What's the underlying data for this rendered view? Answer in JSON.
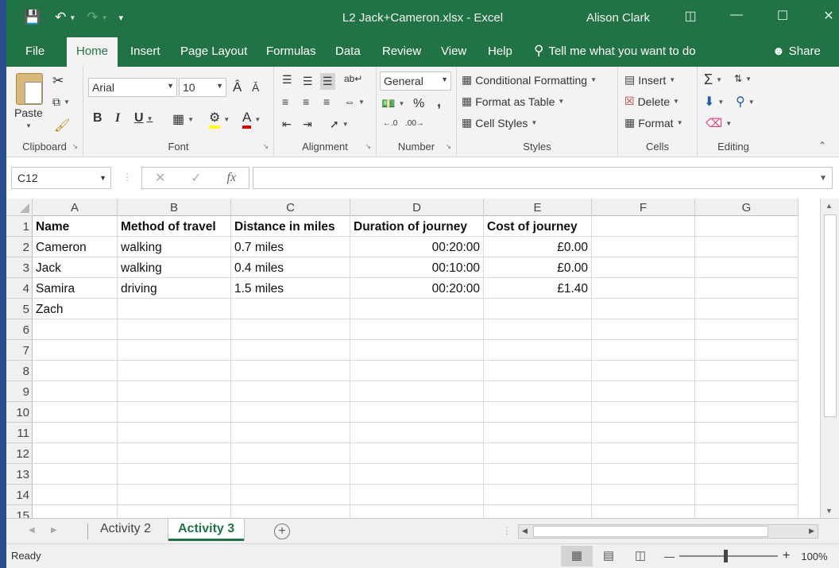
{
  "window": {
    "title": "L2 Jack+Cameron.xlsx  -  Excel",
    "user": "Alison Clark",
    "qat": {
      "save_icon": "save-icon",
      "undo_icon": "undo-icon",
      "redo_icon": "redo-icon"
    }
  },
  "tabs": [
    "File",
    "Home",
    "Insert",
    "Page Layout",
    "Formulas",
    "Data",
    "Review",
    "View",
    "Help"
  ],
  "tell_me": "Tell me what you want to do",
  "share": "Share",
  "ribbon": {
    "clipboard": {
      "label": "Clipboard",
      "paste": "Paste"
    },
    "font": {
      "label": "Font",
      "name": "Arial",
      "size": "10"
    },
    "alignment": {
      "label": "Alignment"
    },
    "number": {
      "label": "Number",
      "format": "General",
      "percent": "%",
      "comma": ","
    },
    "styles": {
      "label": "Styles",
      "conditional": "Conditional Formatting",
      "format_table": "Format as Table",
      "cell_styles": "Cell Styles"
    },
    "cells": {
      "label": "Cells",
      "insert": "Insert",
      "delete": "Delete",
      "format": "Format"
    },
    "editing": {
      "label": "Editing"
    }
  },
  "formula_bar": {
    "name_box": "C12",
    "fx": "fx",
    "value": ""
  },
  "sheet": {
    "columns": [
      "A",
      "B",
      "C",
      "D",
      "E",
      "F",
      "G"
    ],
    "rows": [
      "1",
      "2",
      "3",
      "4",
      "5",
      "6",
      "7",
      "8",
      "9",
      "10",
      "11",
      "12",
      "13",
      "14",
      "15"
    ],
    "cells": [
      [
        "Name",
        "Method of travel",
        "Distance in miles",
        "Duration of journey",
        "Cost of journey",
        "",
        ""
      ],
      [
        "Cameron",
        "walking",
        "0.7 miles",
        "00:20:00",
        "£0.00",
        "",
        ""
      ],
      [
        "Jack",
        "walking",
        "0.4 miles",
        "00:10:00",
        "£0.00",
        "",
        ""
      ],
      [
        "Samira",
        "driving",
        "1.5 miles",
        "00:20:00",
        "£1.40",
        "",
        ""
      ],
      [
        "Zach",
        "",
        "",
        "",
        "",
        "",
        ""
      ]
    ]
  },
  "sheet_tabs": [
    "Activity 2",
    "Activity 3"
  ],
  "active_sheet": "Activity 3",
  "status": {
    "ready": "Ready",
    "zoom": "100%"
  },
  "colors": {
    "accent": "#217346"
  }
}
